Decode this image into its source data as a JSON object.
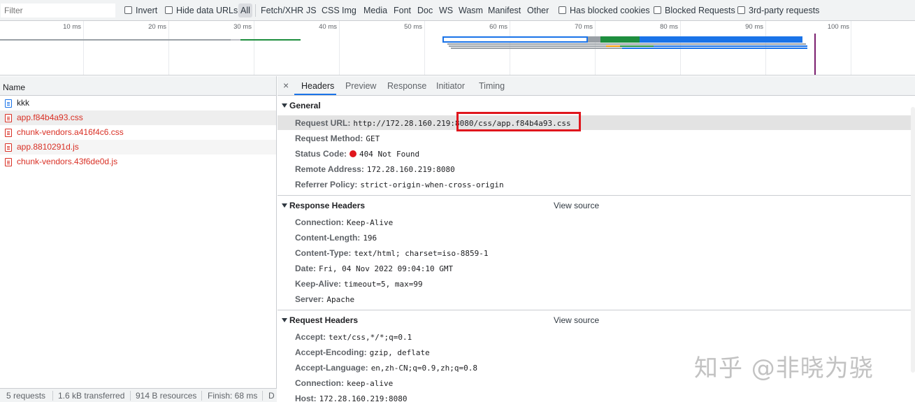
{
  "filter": {
    "placeholder": "Filter",
    "invert": "Invert",
    "hide_data_urls": "Hide data URLs",
    "types": [
      "All",
      "Fetch/XHR",
      "JS",
      "CSS",
      "Img",
      "Media",
      "Font",
      "Doc",
      "WS",
      "Wasm",
      "Manifest",
      "Other"
    ],
    "has_blocked_cookies": "Has blocked cookies",
    "blocked_requests": "Blocked Requests",
    "third_party": "3rd-party requests"
  },
  "overview": {
    "ticks": [
      "10 ms",
      "20 ms",
      "30 ms",
      "40 ms",
      "50 ms",
      "60 ms",
      "70 ms",
      "80 ms",
      "90 ms",
      "100 ms"
    ]
  },
  "requests": {
    "column": "Name",
    "rows": [
      {
        "name": "kkk",
        "status": "ok"
      },
      {
        "name": "app.f84b4a93.css",
        "status": "error"
      },
      {
        "name": "chunk-vendors.a416f4c6.css",
        "status": "error"
      },
      {
        "name": "app.8810291d.js",
        "status": "error"
      },
      {
        "name": "chunk-vendors.43f6de0d.js",
        "status": "error"
      }
    ]
  },
  "summary": {
    "requests": "5 requests",
    "transferred": "1.6 kB transferred",
    "resources": "914 B resources",
    "finish": "Finish: 68 ms",
    "truncated": "D"
  },
  "details": {
    "close": "×",
    "tabs": [
      "Headers",
      "Preview",
      "Response",
      "Initiator",
      "Timing"
    ],
    "active_tab": "Headers",
    "general": {
      "title": "General",
      "rows": [
        {
          "k": "Request URL:",
          "v": "http://172.28.160.219:8080/css/app.f84b4a93.css"
        },
        {
          "k": "Request Method:",
          "v": "GET"
        },
        {
          "k": "Status Code:",
          "v": "404 Not Found"
        },
        {
          "k": "Remote Address:",
          "v": "172.28.160.219:8080"
        },
        {
          "k": "Referrer Policy:",
          "v": "strict-origin-when-cross-origin"
        }
      ]
    },
    "response_headers": {
      "title": "Response Headers",
      "view_source": "View source",
      "rows": [
        {
          "k": "Connection:",
          "v": "Keep-Alive"
        },
        {
          "k": "Content-Length:",
          "v": "196"
        },
        {
          "k": "Content-Type:",
          "v": "text/html; charset=iso-8859-1"
        },
        {
          "k": "Date:",
          "v": "Fri, 04 Nov 2022 09:04:10 GMT"
        },
        {
          "k": "Keep-Alive:",
          "v": "timeout=5, max=99"
        },
        {
          "k": "Server:",
          "v": "Apache"
        }
      ]
    },
    "request_headers": {
      "title": "Request Headers",
      "view_source": "View source",
      "rows": [
        {
          "k": "Accept:",
          "v": "text/css,*/*;q=0.1"
        },
        {
          "k": "Accept-Encoding:",
          "v": "gzip, deflate"
        },
        {
          "k": "Accept-Language:",
          "v": "en,zh-CN;q=0.9,zh;q=0.8"
        },
        {
          "k": "Connection:",
          "v": "keep-alive"
        },
        {
          "k": "Host:",
          "v": "172.28.160.219:8080"
        }
      ]
    }
  },
  "watermark": "知乎 @非晓为骁",
  "colors": {
    "error": "#d93025",
    "accent": "#1a73e8",
    "status_dot": "#e0161d"
  }
}
